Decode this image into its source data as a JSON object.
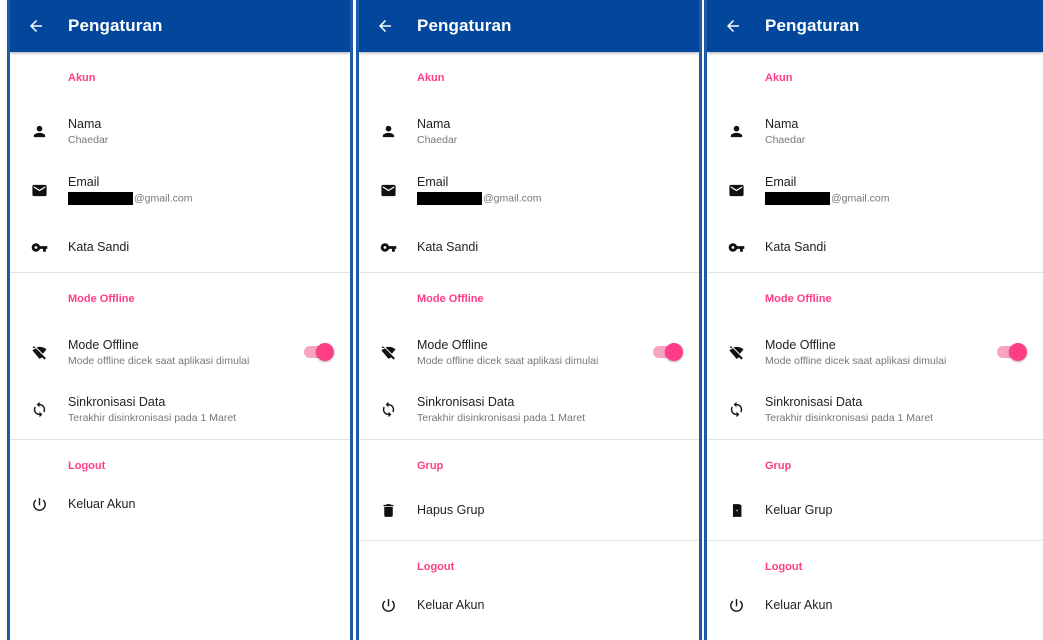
{
  "screens": [
    {
      "app_bar": {
        "back_icon": "arrow-back-icon",
        "title": "Pengaturan"
      },
      "section_account": "Akun",
      "name": {
        "icon": "person-icon",
        "label": "Nama",
        "value": "Chaedar"
      },
      "email": {
        "icon": "mail-icon",
        "label": "Email",
        "value_suffix": "@gmail.com"
      },
      "password": {
        "icon": "key-icon",
        "label": "Kata Sandi"
      },
      "section_offline": "Mode Offline",
      "offline": {
        "icon": "wifi-off-icon",
        "label": "Mode Offline",
        "description": "Mode offline dicek saat aplikasi dimulai",
        "enabled": true
      },
      "sync": {
        "icon": "sync-icon",
        "label": "Sinkronisasi Data",
        "description": "Terakhir disinkronisasi pada 1 Maret"
      },
      "section_logout": "Logout",
      "logout": {
        "icon": "power-icon",
        "label": "Keluar Akun"
      }
    },
    {
      "app_bar": {
        "back_icon": "arrow-back-icon",
        "title": "Pengaturan"
      },
      "section_account": "Akun",
      "name": {
        "icon": "person-icon",
        "label": "Nama",
        "value": "Chaedar"
      },
      "email": {
        "icon": "mail-icon",
        "label": "Email",
        "value_suffix": "@gmail.com"
      },
      "password": {
        "icon": "key-icon",
        "label": "Kata Sandi"
      },
      "section_offline": "Mode Offline",
      "offline": {
        "icon": "wifi-off-icon",
        "label": "Mode Offline",
        "description": "Mode offline dicek saat aplikasi dimulai",
        "enabled": true
      },
      "sync": {
        "icon": "sync-icon",
        "label": "Sinkronisasi Data",
        "description": "Terakhir disinkronisasi pada 1 Maret"
      },
      "section_group": "Grup",
      "group": {
        "icon": "trash-icon",
        "label": "Hapus Grup"
      },
      "section_logout": "Logout",
      "logout": {
        "icon": "power-icon",
        "label": "Keluar Akun"
      }
    },
    {
      "app_bar": {
        "back_icon": "arrow-back-icon",
        "title": "Pengaturan"
      },
      "section_account": "Akun",
      "name": {
        "icon": "person-icon",
        "label": "Nama",
        "value": "Chaedar"
      },
      "email": {
        "icon": "mail-icon",
        "label": "Email",
        "value_suffix": "@gmail.com"
      },
      "password": {
        "icon": "key-icon",
        "label": "Kata Sandi"
      },
      "section_offline": "Mode Offline",
      "offline": {
        "icon": "wifi-off-icon",
        "label": "Mode Offline",
        "description": "Mode offline dicek saat aplikasi dimulai",
        "enabled": true
      },
      "sync": {
        "icon": "sync-icon",
        "label": "Sinkronisasi Data",
        "description": "Terakhir disinkronisasi pada 1 Maret"
      },
      "section_group": "Grup",
      "group": {
        "icon": "exit-door-icon",
        "label": "Keluar Grup"
      },
      "section_logout": "Logout",
      "logout": {
        "icon": "power-icon",
        "label": "Keluar Akun"
      }
    }
  ],
  "colors": {
    "app_bar": "#02479b",
    "accent": "#ff3d86",
    "frame_border": "#1e5aa6"
  }
}
